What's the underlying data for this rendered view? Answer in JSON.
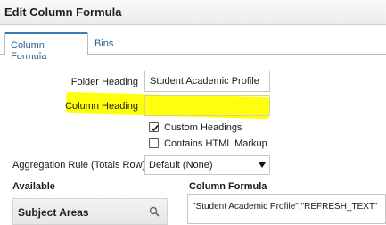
{
  "dialog": {
    "title": "Edit Column Formula"
  },
  "tabs": [
    {
      "label": "Column Formula",
      "active": true
    },
    {
      "label": "Bins",
      "active": false
    }
  ],
  "form": {
    "folder_heading_label": "Folder Heading",
    "folder_heading_value": "Student Academic Profile",
    "column_heading_label": "Column Heading",
    "column_heading_value": "",
    "custom_headings_label": "Custom Headings",
    "custom_headings_checked": true,
    "contains_html_label": "Contains HTML Markup",
    "contains_html_checked": false,
    "aggregation_label": "Aggregation Rule (Totals Row)",
    "aggregation_value": "Default (None)"
  },
  "available": {
    "title": "Available",
    "subject_areas_label": "Subject Areas"
  },
  "column_formula": {
    "title": "Column Formula",
    "text": "\"Student Academic Profile\".\"REFRESH_TEXT\""
  },
  "colors": {
    "highlight": "#ffff00",
    "tab_accent": "#3d7ab8",
    "link_text": "#2a5f93"
  }
}
